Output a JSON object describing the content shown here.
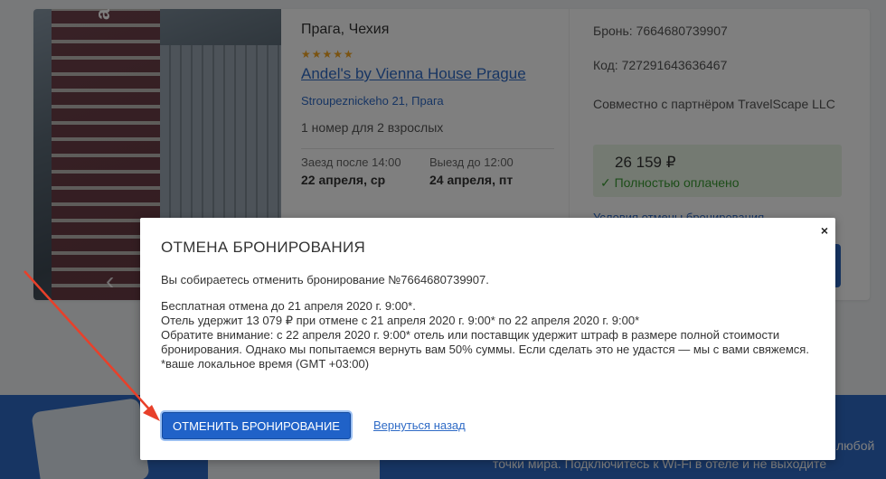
{
  "booking_card": {
    "city": "Прага, Чехия",
    "stars": "★★★★★",
    "hotel_name": "Andel's by Vienna House Prague",
    "address": "Stroupeznickeho 21, Прага",
    "guests": "1 номер для 2 взрослых",
    "checkin_label": "Заезд после 14:00",
    "checkin_date": "22 апреля, ср",
    "checkout_label": "Выезд до 12:00",
    "checkout_date": "24 апреля, пт",
    "photo_sign": "andel's",
    "photo_prev": "‹"
  },
  "summary": {
    "booking_number": "Бронь: 7664680739907",
    "code": "Код: 727291643636467",
    "partner": "Совместно с партнёром TravelScape LLC",
    "price": "26 159 ₽",
    "paid_status": "✓ Полностью оплачено",
    "cancel_terms_link": "Условия отмены бронирования"
  },
  "banner": {
    "text1": "любой",
    "text2": "точки мира. Подключитесь к Wi-Fi в отеле и не выходите"
  },
  "modal": {
    "close": "×",
    "title": "ОТМЕНА БРОНИРОВАНИЯ",
    "lead": "Вы собираетесь отменить бронирование №7664680739907.",
    "line1": "Бесплатная отмена до 21 апреля 2020 г. 9:00*.",
    "line2": "Отель удержит 13 079 ₽ при отмене с 21 апреля 2020 г. 9:00* по 22 апреля 2020 г. 9:00*",
    "line3": "Обратите внимание: с 22 апреля 2020 г. 9:00* отель или поставщик удержит штраф в размере полной стоимости бронирования. Однако мы попытаемся вернуть вам 50% суммы. Если сделать это не удастся — мы с вами свяжемся.",
    "line4": "*ваше локальное время (GMT +03:00)",
    "cancel_button": "ОТМЕНИТЬ БРОНИРОВАНИЕ",
    "back_link": "Вернуться назад"
  },
  "colors": {
    "accent": "#2062c8",
    "link": "#2f6bc6",
    "paid": "#3a9a32",
    "annotation_arrow": "#e8402a"
  }
}
